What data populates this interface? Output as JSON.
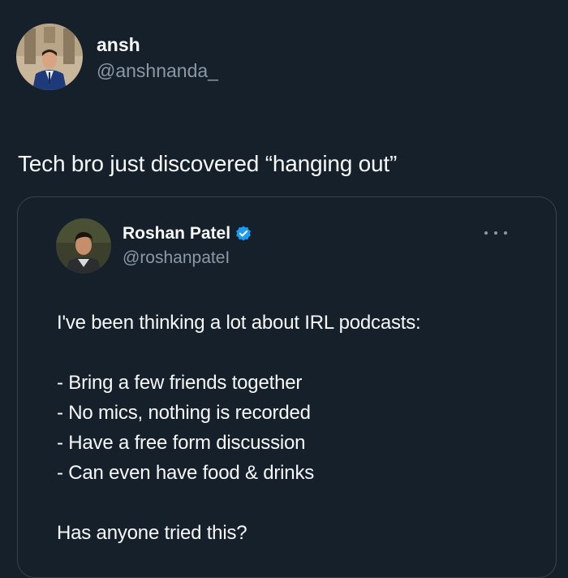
{
  "tweet": {
    "author_name": "ansh",
    "author_handle": "@anshnanda_",
    "text": "Tech bro just discovered “hanging out”"
  },
  "quoted": {
    "author_name": "Roshan Patel",
    "author_handle": "@roshanpateI",
    "verified_icon": "verified-badge-icon",
    "more_icon": "more-options-icon",
    "lines": [
      "I've been thinking a lot about IRL podcasts:",
      "",
      "- Bring a few friends together",
      "- No mics, nothing is recorded",
      "- Have a free form discussion",
      "- Can even have food & drinks",
      "",
      "Has anyone tried this?"
    ]
  },
  "colors": {
    "background": "#15202b",
    "text": "#f7f9f9",
    "secondary_text": "#8b98a5",
    "border": "#38444d",
    "verified_blue": "#1d9bf0"
  }
}
